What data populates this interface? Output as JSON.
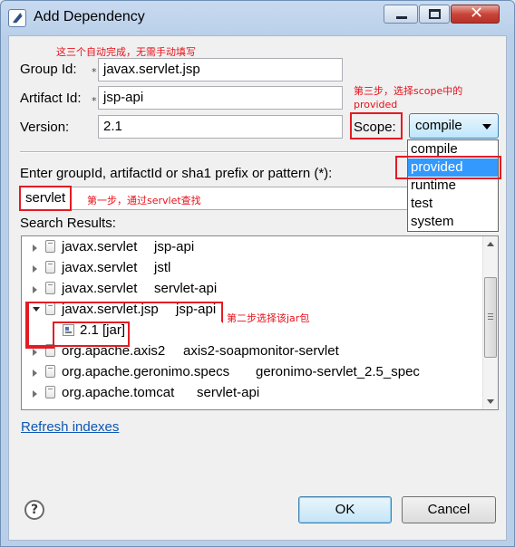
{
  "window": {
    "title": "Add Dependency"
  },
  "annotations": {
    "autocomplete": "这三个自动完成，无需手动填写",
    "step1": "第一步，通过servlet查找",
    "step2": "第二步选择该jar包",
    "step3_line1": "第三步，选择scope中的",
    "step3_line2": "provided"
  },
  "form": {
    "group_id_label": "Group Id:",
    "group_id_value": "javax.servlet.jsp",
    "artifact_id_label": "Artifact Id:",
    "artifact_id_value": "jsp-api",
    "version_label": "Version:",
    "version_value": "2.1",
    "required_marker": "*",
    "scope_label": "Scope:",
    "scope_value": "compile"
  },
  "scope_options": [
    "compile",
    "provided",
    "runtime",
    "test",
    "system"
  ],
  "scope_selected_index": 1,
  "search": {
    "prompt_label": "Enter groupId, artifactId or sha1 prefix or pattern (*):",
    "query": "servlet",
    "results_label": "Search Results:"
  },
  "results": [
    {
      "group": "javax.servlet",
      "artifact": "jsp-api",
      "expanded": false
    },
    {
      "group": "javax.servlet",
      "artifact": "jstl",
      "expanded": false
    },
    {
      "group": "javax.servlet",
      "artifact": "servlet-api",
      "expanded": false
    },
    {
      "group": "javax.servlet.jsp",
      "artifact": "jsp-api",
      "expanded": true
    },
    {
      "version_label": "2.1 [jar]"
    },
    {
      "group": "org.apache.axis2",
      "artifact": "axis2-soapmonitor-servlet",
      "expanded": false
    },
    {
      "group": "org.apache.geronimo.specs",
      "artifact": "geronimo-servlet_2.5_spec",
      "expanded": false
    },
    {
      "group": "org.apache.tomcat",
      "artifact": "servlet-api",
      "expanded": false
    }
  ],
  "links": {
    "refresh": "Refresh indexes"
  },
  "buttons": {
    "help": "?",
    "ok": "OK",
    "cancel": "Cancel"
  }
}
